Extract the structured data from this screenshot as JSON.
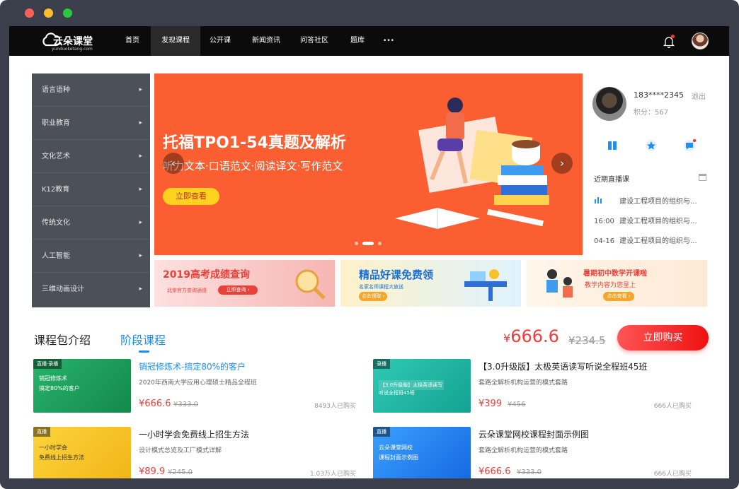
{
  "brand": {
    "name": "云朵课堂",
    "domain": "yunduoketang.com"
  },
  "nav": {
    "items": [
      "首页",
      "发现课程",
      "公开课",
      "新闻资讯",
      "问答社区",
      "题库"
    ],
    "active": "发现课程",
    "more": "•••"
  },
  "categories": [
    "语言语种",
    "职业教育",
    "文化艺术",
    "K12教育",
    "传统文化",
    "人工智能",
    "三维动画设计"
  ],
  "banner": {
    "title": "托福TPO1-54真题及解析",
    "subtitle": "听力文本·口语范文·阅读译文·写作范文",
    "button": "立即查看",
    "prev": "‹",
    "next": "›"
  },
  "sub_banners": [
    {
      "title": "2019高考成绩查询",
      "small": "北京官方查询通道",
      "button": "立即查询 ›"
    },
    {
      "title": "精品好课免费领",
      "small": "名家名师课程大放送",
      "button": "点击领取 ›"
    },
    {
      "title": "暑期初中数学开课啦",
      "small": "教学内容为您呈上",
      "button": "点击查看 ›"
    }
  ],
  "user": {
    "name": "183****2345",
    "logout": "退出",
    "points": "积分：567"
  },
  "live": {
    "heading": "近期直播课",
    "rows": [
      {
        "time": "",
        "title": "建设工程项目的组织与..."
      },
      {
        "time": "16:00",
        "title": "建设工程项目的组织与..."
      },
      {
        "time": "04-16",
        "title": "建设工程项目的组织与..."
      }
    ]
  },
  "tabs": {
    "intro": "课程包介绍",
    "stage": "阶段课程"
  },
  "package": {
    "currency": "¥",
    "price": "666.6",
    "old_price": "¥234.5",
    "buy": "立即购买"
  },
  "courses": [
    {
      "tag": "直播·录播",
      "thumb_text": "销冠修炼术\n搞定80%的客户",
      "title": "销冠修炼术-搞定80%的客户",
      "desc": "2020年西南大学应用心理硕士精品全程班",
      "price": "¥666.6",
      "old": "¥333.0",
      "bought": "8493人已购买",
      "color": "#1f9d55",
      "highlight": true
    },
    {
      "tag": "录播",
      "thumb_text": "【3.0升级版】太极英语读写\n听说全程班45班",
      "title": "【3.0升级版】太极英语读写听说全程班45班",
      "desc": "套路全解析机构运营的模式套路",
      "price": "¥399",
      "old": "¥456",
      "bought": "666人已购买",
      "color": "#1fb8a8",
      "highlight": false
    },
    {
      "tag": "直播",
      "thumb_text": "一小时学会\n免费线上招生方法",
      "title": "一小时学会免费线上招生方法",
      "desc": "设计模式总览及工厂模式详解",
      "price": "¥89.9",
      "old": "¥245.0",
      "bought": "1.03万人已购买",
      "color": "#f7c227",
      "highlight": false
    },
    {
      "tag": "直播",
      "thumb_text": "云朵课堂网校\n课程封面示例图",
      "title": "云朵课堂网校课程封面示例图",
      "desc": "套路全解析机构运营的模式套路",
      "price": "¥666.6",
      "old": "¥333.0",
      "bought": "666人已购买",
      "color": "#1e7ff0",
      "highlight": false
    }
  ]
}
